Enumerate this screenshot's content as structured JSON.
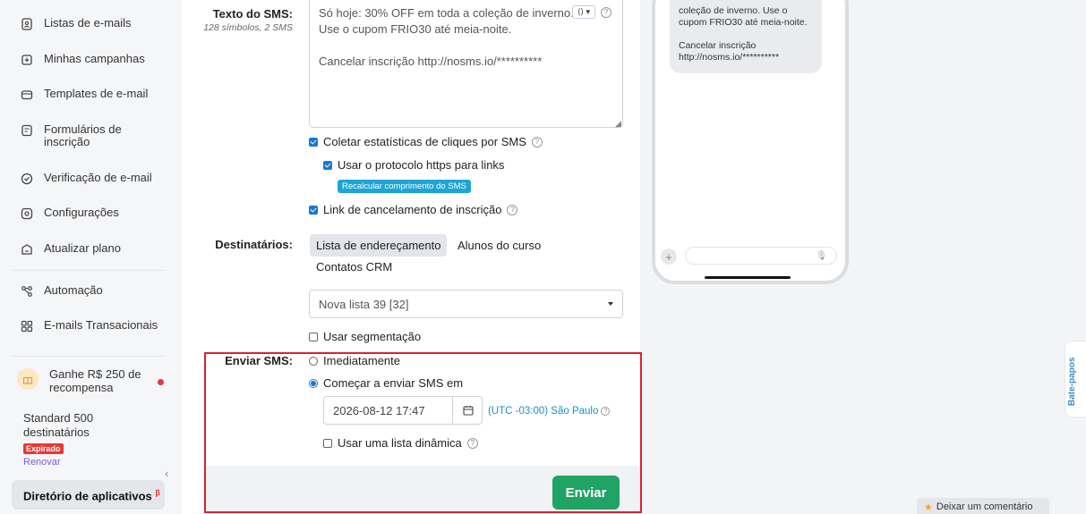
{
  "sidebar": {
    "items": [
      {
        "label": "Listas de e-mails",
        "icon": "contacts-list-icon"
      },
      {
        "label": "Minhas campanhas",
        "icon": "campaigns-icon"
      },
      {
        "label": "Templates de e-mail",
        "icon": "templates-icon"
      },
      {
        "label": "Formulários de inscrição",
        "icon": "form-icon"
      },
      {
        "label": "Verificação de e-mail",
        "icon": "check-circle-icon"
      },
      {
        "label": "Configurações",
        "icon": "settings-icon"
      },
      {
        "label": "Atualizar plano",
        "icon": "upgrade-icon"
      },
      {
        "label": "Automação",
        "icon": "automation-icon"
      },
      {
        "label": "E-mails Transacionais",
        "icon": "transactional-icon"
      }
    ],
    "reward": "Ganhe R$ 250 de recompensa",
    "plan_name": "Standard 500 destinatários",
    "plan_status": "Expirado",
    "renew": "Renovar",
    "app_directory": "Diretório de aplicativos",
    "app_directory_badge": "β"
  },
  "form": {
    "sms_text_label": "Texto do SMS:",
    "sms_text_meta": "128 símbolos, 2 SMS",
    "sms_text_lines": [
      "Só hoje: 30% OFF em toda a coleção de inverno.",
      "Use o cupom FRIO30 até meia-noite.",
      "",
      "Cancelar inscrição http://nosms.io/**********"
    ],
    "collect_clicks": "Coletar estatísticas de cliques por SMS",
    "use_https": "Usar o protocolo https para links",
    "recalc_button": "Recalcular comprimento do SMS",
    "unsubscribe_link": "Link de cancelamento de inscrição",
    "recipients_label": "Destinatários:",
    "recipient_tabs": [
      "Lista de endereçamento",
      "Alunos do curso",
      "Contatos CRM"
    ],
    "selected_list": "Nova lista 39 [32]",
    "use_segmentation": "Usar segmentação",
    "send_label": "Enviar SMS:",
    "send_now": "Imediatamente",
    "send_scheduled": "Começar a enviar SMS em",
    "datetime": "2026-08-12 17:47",
    "timezone": "(UTC -03:00) São Paulo",
    "dynamic_list": "Usar uma lista dinâmica",
    "send_button": "Enviar"
  },
  "preview": {
    "bubble_lines": [
      "coleção de inverno. Use o",
      "cupom FRIO30 até meia-noite.",
      "",
      "Cancelar inscrição",
      "http://nosms.io/**********"
    ]
  },
  "chats_tab": "Bate-papos",
  "feedback_button": "Deixar um comentário"
}
